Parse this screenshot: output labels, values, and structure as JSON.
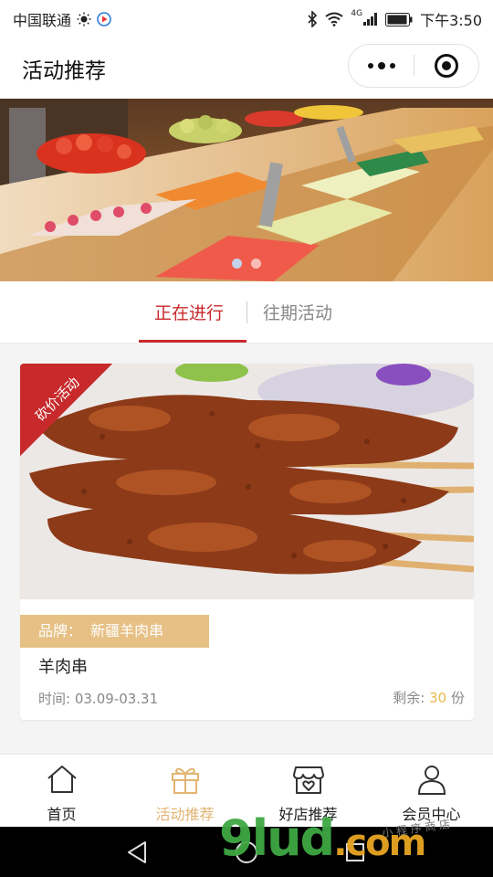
{
  "status_bar": {
    "carrier": "中国联通",
    "network": "4G",
    "time": "下午3:50"
  },
  "navbar": {
    "title": "活动推荐"
  },
  "banner": {
    "slide_count": 2,
    "active_index": 1
  },
  "tabs": [
    {
      "label": "正在进行",
      "active": true
    },
    {
      "label": "往期活动",
      "active": false
    }
  ],
  "activity": {
    "ribbon": "砍价活动",
    "brand_label": "品牌：",
    "brand_value": "新疆羊肉串",
    "name": "羊肉串",
    "time_label": "时间:",
    "time_value": "03.09-03.31",
    "remain_label": "剩余:",
    "remain_count": "30",
    "remain_unit": "份"
  },
  "tabbar": [
    {
      "label": "首页",
      "icon": "home-icon",
      "active": false
    },
    {
      "label": "活动推荐",
      "icon": "gift-icon",
      "active": true
    },
    {
      "label": "好店推荐",
      "icon": "shop-icon",
      "active": false
    },
    {
      "label": "会员中心",
      "icon": "user-icon",
      "active": false
    }
  ],
  "watermark": {
    "brand": "9lud",
    "suffix": ".com",
    "small_text": "小 程 序 商 店"
  },
  "colors": {
    "accent_red": "#c8292b",
    "gold": "#e6c084",
    "tab_active": "#e2b472"
  }
}
